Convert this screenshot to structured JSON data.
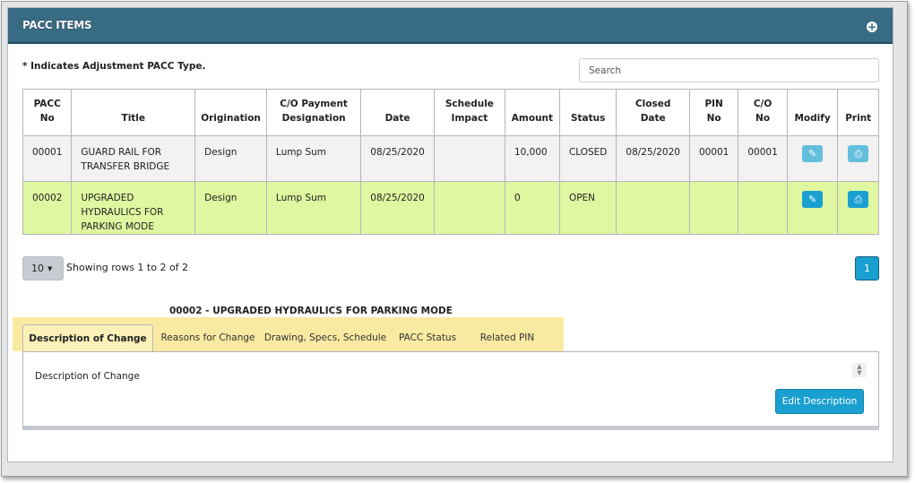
{
  "panel": {
    "title": "PACC ITEMS",
    "expand_icon": "plus-circle-icon"
  },
  "note": "* Indicates Adjustment PACC Type.",
  "search": {
    "placeholder": "Search",
    "value": ""
  },
  "table": {
    "headers": [
      "PACC No",
      "Title",
      "Origination",
      "C/O Payment Designation",
      "Date",
      "Schedule Impact",
      "Amount",
      "Status",
      "Closed Date",
      "PIN No",
      "C/O No",
      "Modify",
      "Print"
    ],
    "rows": [
      {
        "pacc_no": "00001",
        "title": "GUARD RAIL FOR TRANSFER BRIDGE",
        "origination": "Design",
        "payment_designation": "Lump Sum",
        "date": "08/25/2020",
        "schedule_impact": "",
        "amount": "10,000",
        "status": "CLOSED",
        "closed_date": "08/25/2020",
        "pin_no": "00001",
        "co_no": "00001",
        "modify_icon": "edit-icon",
        "print_icon": "print-icon"
      },
      {
        "pacc_no": "00002",
        "title": "UPGRADED HYDRAULICS FOR PARKING MODE",
        "origination": "Design",
        "payment_designation": "Lump Sum",
        "date": "08/25/2020",
        "schedule_impact": "",
        "amount": "0",
        "status": "OPEN",
        "closed_date": "",
        "pin_no": "",
        "co_no": "",
        "modify_icon": "edit-icon",
        "print_icon": "print-icon"
      }
    ]
  },
  "pagination": {
    "page_size": "10",
    "showing": "Showing rows 1 to 2 of 2",
    "current_page": "1"
  },
  "detail": {
    "title": "00002 - UPGRADED HYDRAULICS FOR PARKING MODE",
    "tabs": [
      {
        "label": "Description of Change",
        "active": true
      },
      {
        "label": "Reasons for Change",
        "active": false
      },
      {
        "label": "Drawing, Specs, Schedule",
        "active": false
      },
      {
        "label": "PACC Status",
        "active": false
      },
      {
        "label": "Related PIN",
        "active": false
      }
    ],
    "content_label": "Description of Change",
    "edit_button": "Edit Description"
  },
  "colors": {
    "header_bg": "#386b84",
    "selected_row": "#dff7a0",
    "tab_highlight": "#f9eaa2",
    "primary_button": "#1a9fd1"
  }
}
